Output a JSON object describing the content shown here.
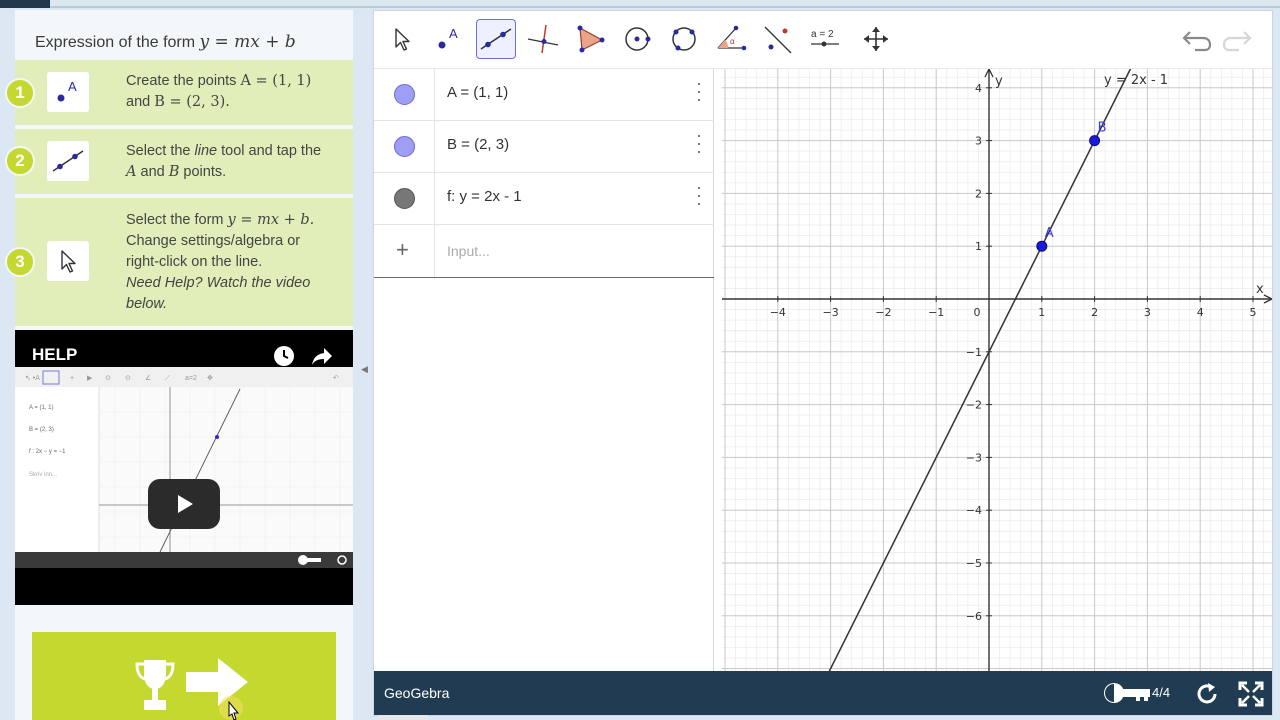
{
  "activity": {
    "title_text": "Expression of the form ",
    "title_math": "y = mx + b",
    "steps": [
      {
        "num": "1",
        "line1_pre": "Create the points ",
        "line1_math": "A = (1, 1)",
        "line2_pre": "and ",
        "line2_math": "B = (2, 3).",
        "icon": "point-tool-icon"
      },
      {
        "num": "2",
        "line1_pre": "Select the ",
        "line1_em": "line",
        "line1_post": " tool and tap the",
        "line2_m1": "A",
        "line2_mid": " and ",
        "line2_m2": "B",
        "line2_post": " points.",
        "icon": "line-tool-icon"
      },
      {
        "num": "3",
        "line1_pre": "Select the form ",
        "line1_math": "y = mx + b.",
        "line2": "Change settings/algebra or",
        "line3": "right-click on the line.",
        "line4": "Need Help? Watch the video",
        "line5": "below.",
        "icon": "move-tool-icon"
      }
    ]
  },
  "video": {
    "title": "HELP",
    "thumb_rows": [
      "A = (1, 1)",
      "B = (2, 3)",
      "f : 2x − y = −1",
      "Skriv inn..."
    ],
    "play_icon": "play-icon",
    "clock_icon": "clock-icon",
    "share_icon": "share-icon"
  },
  "next": {
    "trophy_icon": "trophy-icon",
    "arrow_icon": "arrow-right-icon"
  },
  "geogebra": {
    "tools": [
      "move-tool-icon",
      "point-tool-icon",
      "line-tool-icon",
      "perpendicular-tool-icon",
      "polygon-tool-icon",
      "circle-center-tool-icon",
      "circle-three-points-tool-icon",
      "angle-tool-icon",
      "reflect-tool-icon",
      "slider-tool-icon",
      "move-graphics-tool-icon"
    ],
    "slider_label": "a = 2",
    "algebra": [
      {
        "label": "A = (1, 1)",
        "color": "#9e9ef5"
      },
      {
        "label": "B = (2, 3)",
        "color": "#9e9ef5"
      },
      {
        "label": "f:  y = 2x - 1",
        "color": "#777777"
      }
    ],
    "input_placeholder": "Input...",
    "brand": "GeoGebra",
    "page_counter": "4/4"
  },
  "chart_data": {
    "type": "line",
    "xlabel": "x",
    "ylabel": "y",
    "xlim": [
      -5,
      5
    ],
    "ylim": [
      -6,
      4
    ],
    "x_ticks": [
      -4,
      -3,
      -2,
      -1,
      0,
      1,
      2,
      3,
      4,
      5
    ],
    "y_ticks": [
      4,
      3,
      2,
      1,
      -1,
      -2,
      -3,
      -4,
      -5,
      -6
    ],
    "grid": true,
    "series": [
      {
        "name": "y = 2x - 1",
        "slope": 2,
        "intercept": -1
      }
    ],
    "points": [
      {
        "name": "A",
        "x": 1,
        "y": 1
      },
      {
        "name": "B",
        "x": 2,
        "y": 3
      }
    ]
  }
}
